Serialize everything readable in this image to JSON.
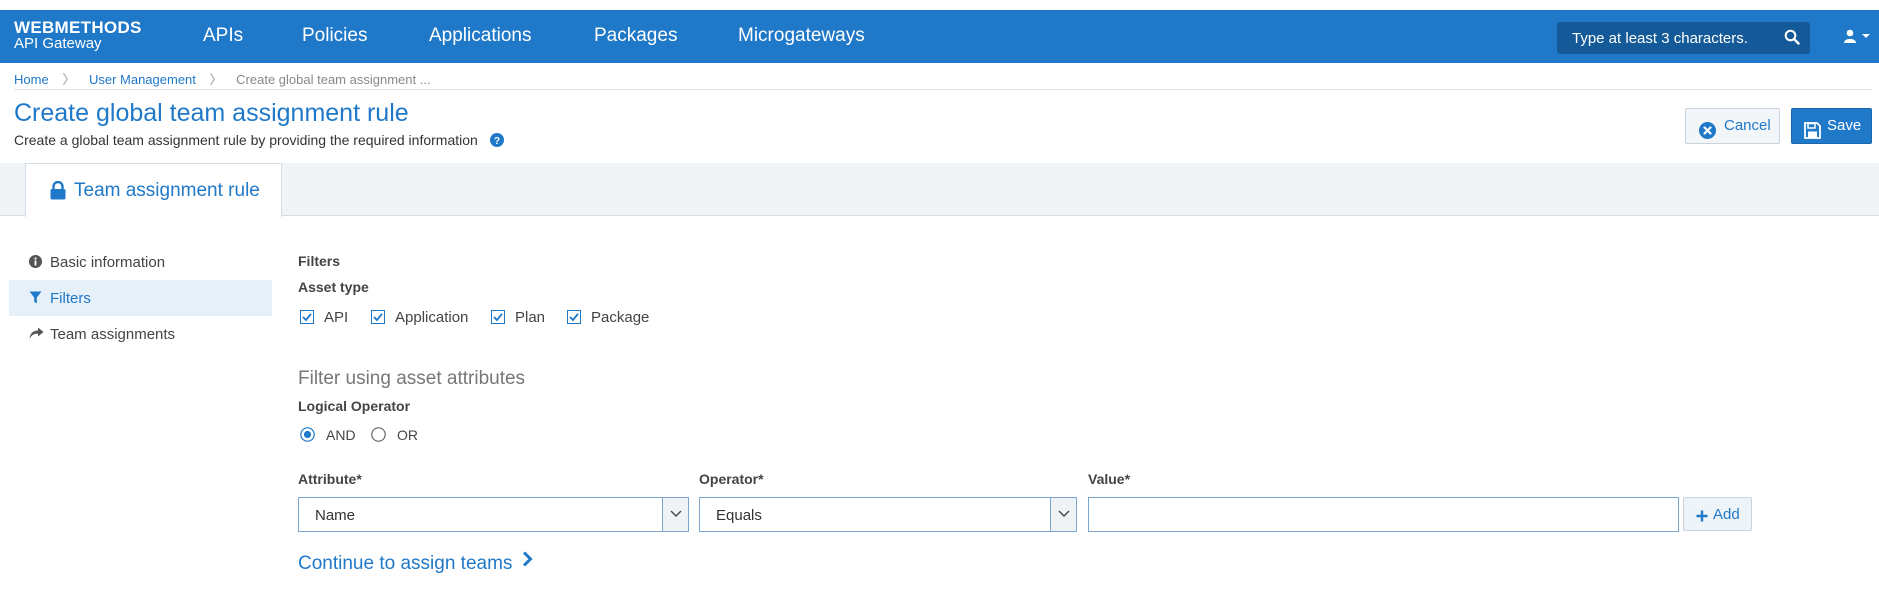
{
  "header": {
    "brand_line1": "WEBMETHODS",
    "brand_line2": "API Gateway",
    "nav": [
      "APIs",
      "Policies",
      "Applications",
      "Packages",
      "Microgateways"
    ],
    "search_placeholder": "Type at least 3 characters."
  },
  "breadcrumb": {
    "home": "Home",
    "user_management": "User Management",
    "current": "Create global team assignment ..."
  },
  "page": {
    "title": "Create global team assignment rule",
    "subtitle": "Create a global team assignment rule by providing the required information"
  },
  "actions": {
    "cancel": "Cancel",
    "save": "Save"
  },
  "tab": {
    "label": "Team assignment rule"
  },
  "sidebar": {
    "items": [
      {
        "label": "Basic information",
        "icon": "info-icon"
      },
      {
        "label": "Filters",
        "icon": "filter-icon"
      },
      {
        "label": "Team assignments",
        "icon": "share-icon"
      }
    ],
    "active_index": 1
  },
  "filters": {
    "heading": "Filters",
    "asset_type_label": "Asset type",
    "asset_types": [
      {
        "label": "API",
        "checked": true
      },
      {
        "label": "Application",
        "checked": true
      },
      {
        "label": "Plan",
        "checked": true
      },
      {
        "label": "Package",
        "checked": true
      }
    ],
    "attr_heading": "Filter using asset attributes",
    "logical_label": "Logical Operator",
    "logical_options": [
      {
        "label": "AND",
        "selected": true
      },
      {
        "label": "OR",
        "selected": false
      }
    ],
    "attribute_label": "Attribute*",
    "attribute_value": "Name",
    "operator_label": "Operator*",
    "operator_value": "Equals",
    "value_label": "Value*",
    "value": "",
    "add_label": "Add",
    "continue_label": "Continue to assign teams"
  },
  "colors": {
    "primary": "#1f78c8",
    "navbar": "#1f78c8",
    "search_bg": "#155a98",
    "tabbar_bg": "#f0f4f7"
  }
}
